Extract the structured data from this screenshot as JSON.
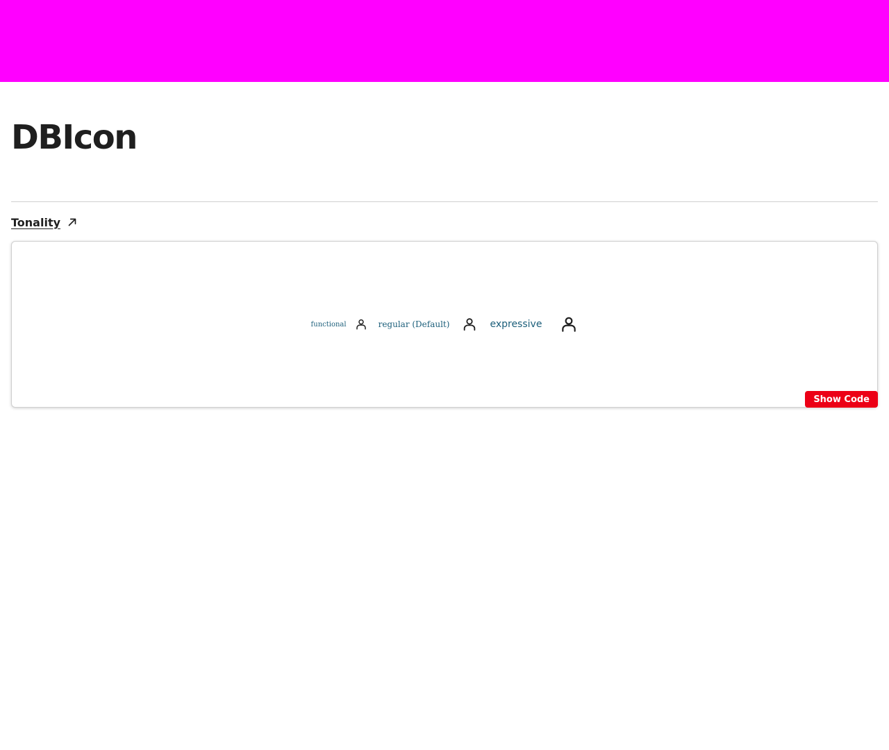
{
  "colors": {
    "banner": "#ff00ff",
    "accent": "#ec0016",
    "variant_text": "#1b5e7a"
  },
  "header": {
    "title": "DBIcon"
  },
  "section": {
    "link_label": "Tonality",
    "link_icon": "arrow-up-right-icon"
  },
  "preview": {
    "variants": [
      {
        "label": "functional",
        "icon": "person-icon"
      },
      {
        "label": "regular (Default)",
        "icon": "person-icon"
      },
      {
        "label": "expressive",
        "icon": "person-icon"
      }
    ],
    "show_code_label": "Show Code"
  }
}
